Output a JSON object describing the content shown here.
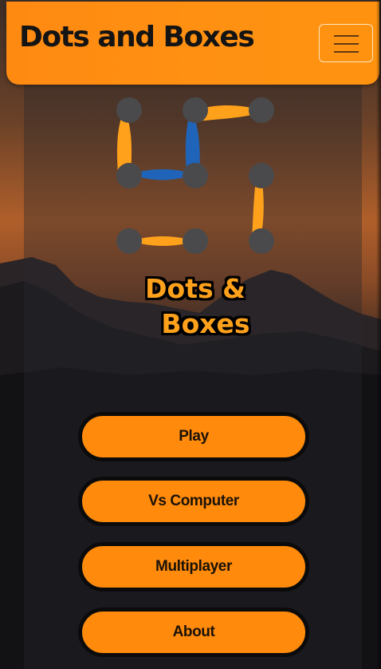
{
  "navbar": {
    "brand": "Dots and Boxes",
    "toggle_icon": "hamburger-icon"
  },
  "hero": {
    "logo_icon": "dots-and-boxes-logo-icon",
    "title_line1": "Dots &",
    "title_line2": "Boxes"
  },
  "menu": {
    "play_label": "Play",
    "vs_computer_label": "Vs Computer",
    "multiplayer_label": "Multiplayer",
    "about_label": "About"
  },
  "colors": {
    "accent_orange": "#ff8a0c",
    "logo_orange": "#ffa11b",
    "logo_blue": "#1f64b8",
    "dot_gray": "#4a4a4c"
  }
}
